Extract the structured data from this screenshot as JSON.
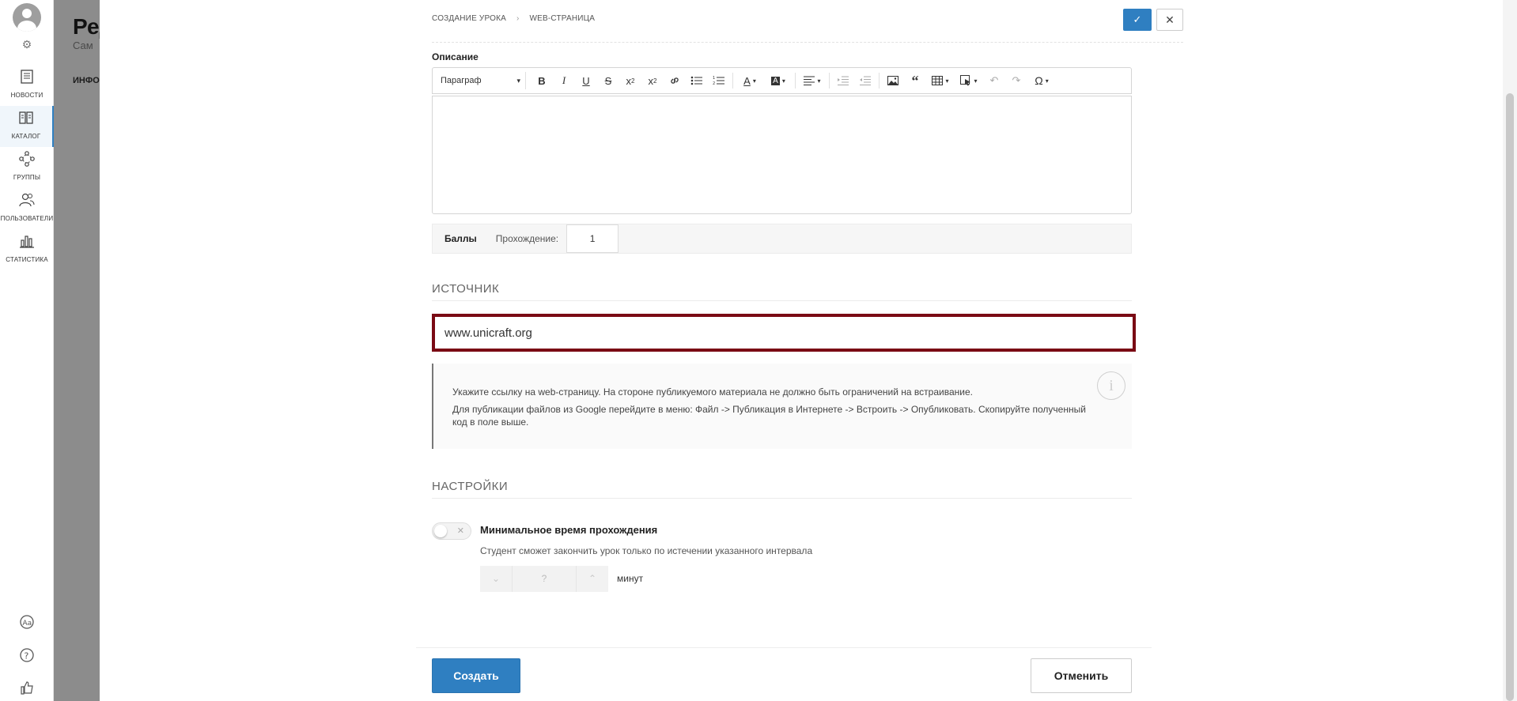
{
  "nav": {
    "items": [
      {
        "label": "НОВОСТИ",
        "icon": "news-icon"
      },
      {
        "label": "КАТАЛОГ",
        "icon": "catalog-icon"
      },
      {
        "label": "ГРУППЫ",
        "icon": "groups-icon"
      },
      {
        "label": "ПОЛЬЗОВАТЕЛИ",
        "icon": "users-icon"
      },
      {
        "label": "СТАТИСТИКА",
        "icon": "statistics-icon"
      }
    ],
    "active_index": 1,
    "bottom_icons": [
      "font-size-icon",
      "help-icon",
      "like-icon"
    ]
  },
  "background_page": {
    "title": "Ред",
    "subtitle": "Сам",
    "tab": "ИНФО"
  },
  "drawer": {
    "breadcrumb": [
      "СОЗДАНИЕ УРОКА",
      "WEB-СТРАНИЦА"
    ],
    "description_label": "Описание",
    "editor": {
      "paragraph_select": "Параграф",
      "value": ""
    },
    "scores": {
      "title": "Баллы",
      "pass_label": "Прохождение:",
      "pass_value": "1"
    },
    "source": {
      "heading": "ИСТОЧНИК",
      "url_value": "www.unicraft.org"
    },
    "hint": {
      "line1": "Укажите ссылку на web-страницу. На стороне публикуемого материала не должно быть ограничений на встраивание.",
      "line2": "Для публикации файлов из Google перейдите в меню: Файл -> Публикация в Интернете -> Встроить -> Опубликовать. Скопируйте полученный код в поле выше."
    },
    "settings": {
      "heading": "НАСТРОЙКИ",
      "min_time_title": "Минимальное время прохождения",
      "min_time_desc": "Студент сможет закончить урок только по истечении указанного интервала",
      "min_time_enabled": false,
      "minutes_value": "?",
      "minutes_label": "минут"
    },
    "buttons": {
      "create": "Создать",
      "cancel": "Отменить"
    }
  },
  "colors": {
    "accent": "#2f7fc1",
    "source_border": "#7a0a14"
  }
}
